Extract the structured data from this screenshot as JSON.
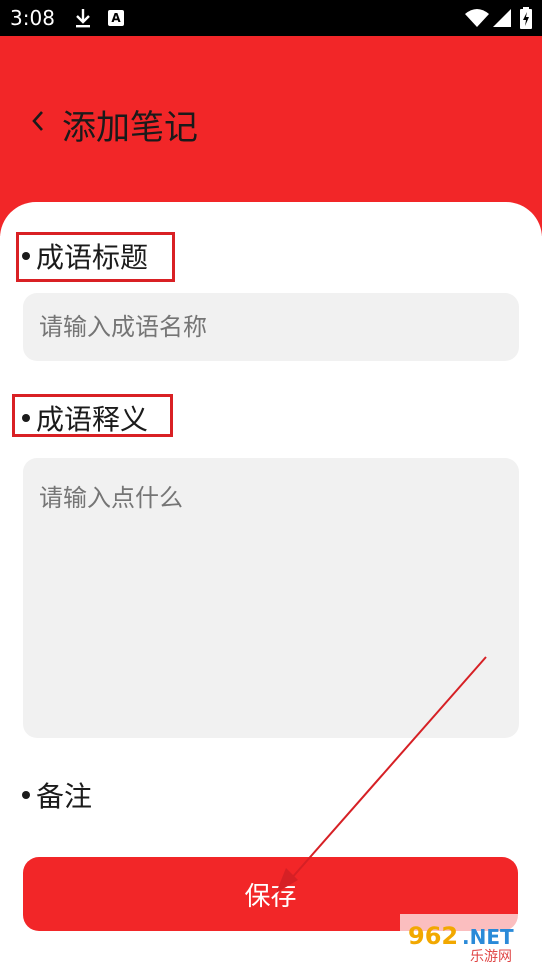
{
  "status_bar": {
    "time": "3:08",
    "icons": [
      "download-icon",
      "a-notification-icon",
      "wifi-icon",
      "signal-icon",
      "battery-icon"
    ],
    "a_icon_text": "A"
  },
  "header": {
    "back_icon": "chevron-left-icon",
    "title": "添加笔记",
    "background": "#f22628"
  },
  "form": {
    "title_label": "成语标题",
    "title_placeholder": "请输入成语名称",
    "meaning_label": "成语释义",
    "meaning_placeholder": "请输入点什么",
    "note_label": "备注"
  },
  "save_button": {
    "label": "保存",
    "color": "#f22628"
  },
  "watermark": {
    "text": "962.NET",
    "subtext": "乐游网"
  }
}
